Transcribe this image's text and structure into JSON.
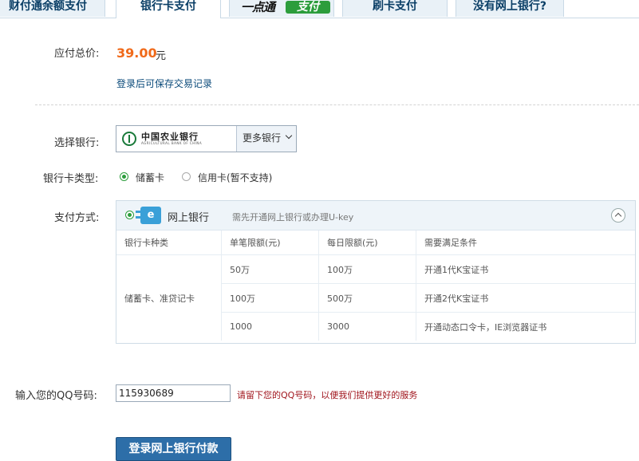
{
  "tabs": [
    {
      "label": "财付通余额支付"
    },
    {
      "label": "银行卡支付"
    },
    {
      "label_left": "一点通",
      "label_right": "支付"
    },
    {
      "label": "刷卡支付"
    },
    {
      "label": "没有网上银行?"
    }
  ],
  "payment": {
    "total_label": "应付总价:",
    "amount": "39.00",
    "currency": "元",
    "login_link": "登录后可保存交易记录"
  },
  "bank": {
    "label": "选择银行:",
    "selected_name": "中国农业银行",
    "selected_name_en": "AGRICULTURAL BANK OF CHINA",
    "more_label": "更多银行"
  },
  "card_type": {
    "label": "银行卡类型:",
    "options": [
      "储蓄卡",
      "信用卡(暂不支持)"
    ],
    "selected": "储蓄卡"
  },
  "pay_method": {
    "label": "支付方式:",
    "option_label": "网上银行",
    "option_icon_text": "e",
    "option_hint": "需先开通网上银行或办理U-key",
    "table": {
      "headers": [
        "银行卡种类",
        "单笔限额(元)",
        "每日限额(元)",
        "需要满足条件"
      ],
      "card_kind": "储蓄卡、准贷记卡",
      "rows": [
        [
          "50万",
          "100万",
          "开通1代K宝证书"
        ],
        [
          "100万",
          "500万",
          "开通2代K宝证书"
        ],
        [
          "1000",
          "3000",
          "开通动态口令卡，IE浏览器证书"
        ]
      ]
    }
  },
  "qq": {
    "label": "输入您的QQ号码:",
    "value": "115930689",
    "hint": "请留下您的QQ号码，以便我们提供更好的服务"
  },
  "submit_label": "登录网上银行付款",
  "colors": {
    "accent_price": "#f06a1a",
    "link": "#0a4a7a",
    "hint_red": "#a0141c",
    "button": "#2d6ea8"
  }
}
